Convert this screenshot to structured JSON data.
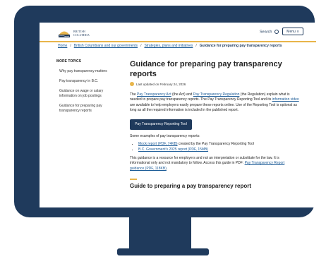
{
  "header": {
    "logo_line1": "BRITISH",
    "logo_line2": "COLUMBIA",
    "search_label": "Search",
    "menu_label": "Menu"
  },
  "breadcrumb": {
    "home": "Home",
    "level2": "British Columbians and our governments",
    "level3": "Strategies, plans and initiatives",
    "current": "Guidance for preparing pay transparency reports"
  },
  "sidebar": {
    "title": "MORE TOPICS",
    "items": [
      "Why pay transparency matters",
      "Pay transparency in B.C.",
      "Guidance on wage or salary information on job postings",
      "Guidance for preparing pay transparency reports"
    ]
  },
  "main": {
    "title": "Guidance for preparing pay transparency reports",
    "updated": "Last updated on February 24, 2026",
    "p1_a": "The ",
    "p1_link1": "Pay Transparency Act",
    "p1_b": " (the Act) and ",
    "p1_link2": "Pay Transparency Regulation",
    "p1_c": " (the Regulation) explain what is needed to prepare pay transparency reports. The Pay Transparency Reporting Tool and its ",
    "p1_link3": "information video",
    "p1_d": " are available to help employers easily prepare these reports online. Use of the Reporting Tool is optional as long as all the required information is included in the published report.",
    "tool_button": "Pay Transparency Reporting Tool",
    "examples_intro": "Some examples of pay transparency reports:",
    "example1_link": "Mock report (PDF, 74KB)",
    "example1_rest": " created by the Pay Transparency Reporting Tool",
    "example2_link": "B.C. Government's 2025 report (PDF, 15MB)",
    "p2_a": "This guidance is a resource for employers and not an interpretation or substitute for the law. It is informational only and not mandatory to follow. Access this guide in PDF: ",
    "p2_link": "Pay Transparency Report guidance (PDF, 118KB)",
    "p2_b": ".",
    "section_title": "Guide to preparing a pay transparency report"
  },
  "colors": {
    "frame": "#1f3a5c",
    "accent": "#e8b54a",
    "link": "#1a5a96"
  }
}
